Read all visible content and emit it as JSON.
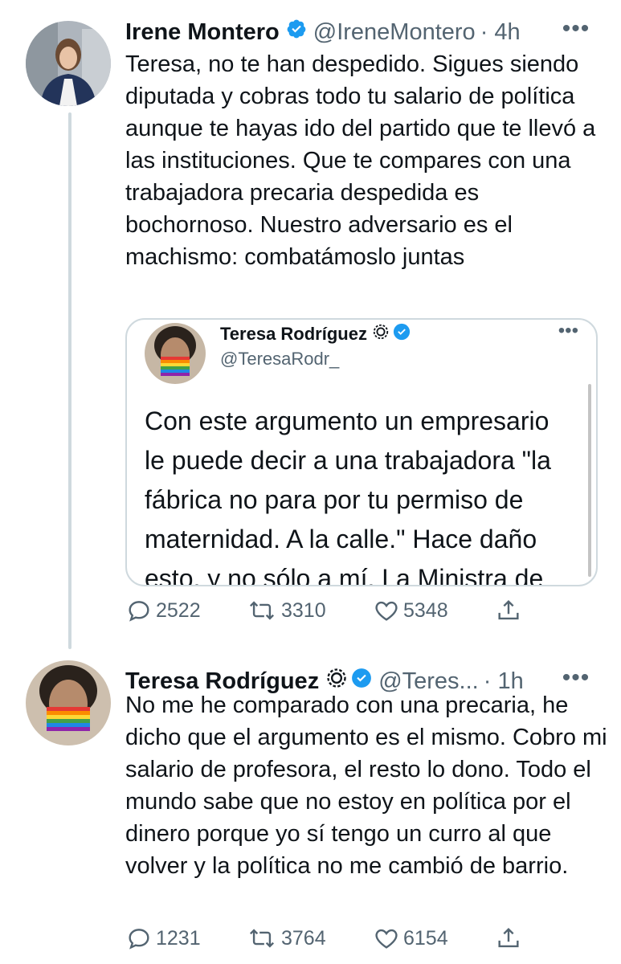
{
  "tweet1": {
    "name": "Irene Montero",
    "handle": "@IreneMontero",
    "time": "· 4h",
    "more": "•••",
    "text": "Teresa, no te han despedido. Sigues siendo diputada y cobras todo tu salario de política aunque te hayas ido del partido que te llevó a las instituciones. Que te compares con una trabajadora precaria despedida es bochornoso. Nuestro adversario es el machismo: combatámoslo juntas",
    "quote": {
      "name": "Teresa Rodríguez",
      "handle": "@TeresaRodr_",
      "more": "•••",
      "text": "Con este argumento un empresario\nle puede decir a una trabajadora \"la\nfábrica no para por tu permiso de\nmaternidad. A la calle.\" Hace daño\nesto, y no sólo a mí. La Ministra de"
    },
    "replies": "2522",
    "retweets": "3310",
    "likes": "5348"
  },
  "tweet2": {
    "name": "Teresa Rodríguez",
    "handle": "@Teres...",
    "time": "· 1h",
    "more": "•••",
    "text": "No me he comparado con una precaria, he dicho que el argumento es el mismo. Cobro mi salario de profesora, el resto lo dono. Todo el mundo sabe que no estoy en política por el dinero porque yo sí tengo un curro al que volver y la política no me cambió de barrio.",
    "replies": "1231",
    "retweets": "3764",
    "likes": "6154"
  },
  "icons": {
    "verified": "verified-badge-icon",
    "settings_badge": "gear-badge-icon",
    "reply": "reply-icon",
    "retweet": "retweet-icon",
    "like": "heart-icon",
    "share": "share-icon"
  },
  "colors": {
    "verified": "#1d9bf0",
    "muted": "#536471",
    "text": "#0f1419",
    "border": "#cfd9de"
  }
}
